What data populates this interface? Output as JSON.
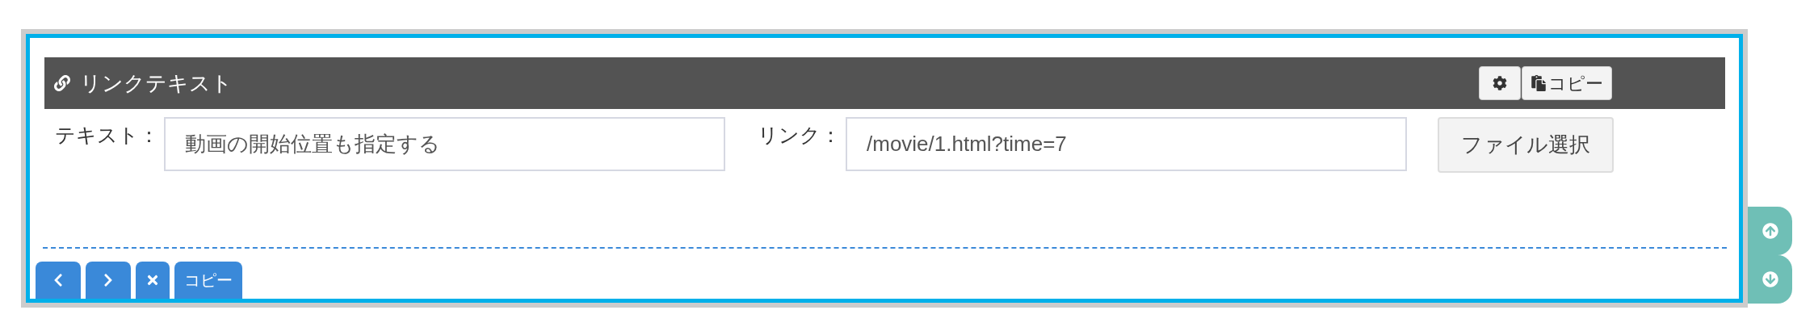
{
  "header": {
    "title": "リンクテキスト",
    "buttons": [
      {
        "kind": "settings"
      },
      {
        "kind": "copy",
        "label": "コピー"
      }
    ]
  },
  "fields": [
    {
      "label": "テキスト：",
      "value": "動画の開始位置も指定する"
    },
    {
      "label": "リンク：",
      "value": "/movie/1.html?time=7"
    }
  ],
  "file_button": "ファイル選択",
  "footer_buttons": [
    {
      "kind": "prev"
    },
    {
      "kind": "next"
    },
    {
      "kind": "delete"
    },
    {
      "kind": "copy",
      "label": "コピー"
    }
  ],
  "side_buttons": [
    {
      "kind": "up"
    },
    {
      "kind": "down"
    }
  ]
}
